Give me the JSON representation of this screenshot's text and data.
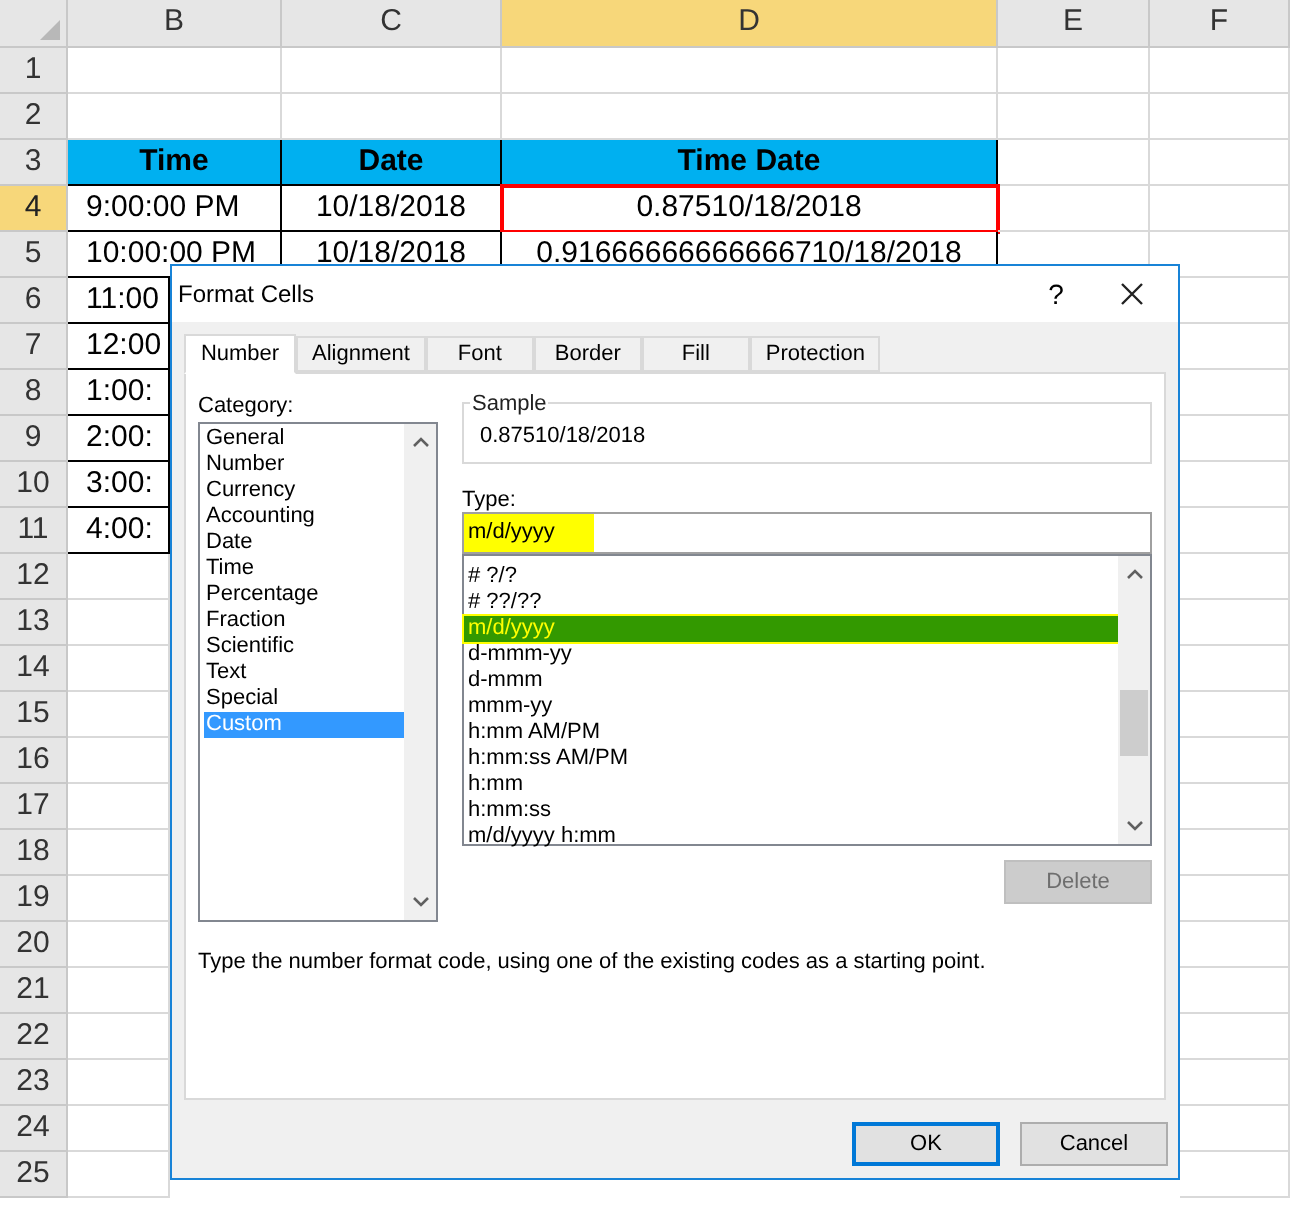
{
  "sheet": {
    "columns": [
      {
        "label": "B",
        "selected": false
      },
      {
        "label": "C",
        "selected": false
      },
      {
        "label": "D",
        "selected": true
      },
      {
        "label": "E",
        "selected": false
      },
      {
        "label": "F",
        "selected": false
      }
    ],
    "rows": [
      {
        "label": "1",
        "selected": false,
        "kind": "empty"
      },
      {
        "label": "2",
        "selected": false,
        "kind": "empty"
      },
      {
        "label": "3",
        "selected": false,
        "kind": "header",
        "cells": [
          {
            "text": "Time",
            "selected": false
          },
          {
            "text": "Date",
            "selected": false
          },
          {
            "text": "Time Date",
            "selected": false
          }
        ]
      },
      {
        "label": "4",
        "selected": true,
        "kind": "data",
        "cells": [
          {
            "text": "9:00:00 PM",
            "selected": false
          },
          {
            "text": "10/18/2018",
            "selected": false
          },
          {
            "text": "0.87510/18/2018",
            "selected": true
          }
        ]
      },
      {
        "label": "5",
        "selected": false,
        "kind": "data",
        "cells": [
          {
            "text": "10:00:00 PM",
            "selected": false
          },
          {
            "text": "10/18/2018",
            "selected": false
          },
          {
            "text": "0.91666666666666710/18/2018",
            "selected": false
          }
        ]
      },
      {
        "label": "6",
        "selected": false,
        "kind": "data",
        "cells": [
          {
            "text": "11:00",
            "selected": false
          }
        ]
      },
      {
        "label": "7",
        "selected": false,
        "kind": "data",
        "cells": [
          {
            "text": "12:00",
            "selected": false
          }
        ]
      },
      {
        "label": "8",
        "selected": false,
        "kind": "data",
        "cells": [
          {
            "text": "1:00:",
            "selected": false
          }
        ]
      },
      {
        "label": "9",
        "selected": false,
        "kind": "data",
        "cells": [
          {
            "text": "2:00:",
            "selected": false
          }
        ]
      },
      {
        "label": "10",
        "selected": false,
        "kind": "data",
        "cells": [
          {
            "text": "3:00:",
            "selected": false
          }
        ]
      },
      {
        "label": "11",
        "selected": false,
        "kind": "data",
        "cells": [
          {
            "text": "4:00:",
            "selected": false
          }
        ]
      },
      {
        "label": "12",
        "selected": false,
        "kind": "empty"
      },
      {
        "label": "13",
        "selected": false,
        "kind": "empty"
      },
      {
        "label": "14",
        "selected": false,
        "kind": "empty"
      },
      {
        "label": "15",
        "selected": false,
        "kind": "empty"
      },
      {
        "label": "16",
        "selected": false,
        "kind": "empty"
      },
      {
        "label": "17",
        "selected": false,
        "kind": "empty"
      },
      {
        "label": "18",
        "selected": false,
        "kind": "empty"
      },
      {
        "label": "19",
        "selected": false,
        "kind": "empty"
      },
      {
        "label": "20",
        "selected": false,
        "kind": "empty"
      },
      {
        "label": "21",
        "selected": false,
        "kind": "empty"
      },
      {
        "label": "22",
        "selected": false,
        "kind": "empty"
      },
      {
        "label": "23",
        "selected": false,
        "kind": "empty"
      },
      {
        "label": "24",
        "selected": false,
        "kind": "empty"
      },
      {
        "label": "25",
        "selected": false,
        "kind": "empty"
      }
    ]
  },
  "dialog": {
    "title": "Format Cells",
    "help": "?",
    "tabs": [
      {
        "label": "Number",
        "selected": true
      },
      {
        "label": "Alignment",
        "selected": false
      },
      {
        "label": "Font",
        "selected": false
      },
      {
        "label": "Border",
        "selected": false
      },
      {
        "label": "Fill",
        "selected": false
      },
      {
        "label": "Protection",
        "selected": false
      }
    ],
    "category_label": "Category:",
    "categories": [
      {
        "label": "General",
        "selected": false
      },
      {
        "label": "Number",
        "selected": false
      },
      {
        "label": "Currency",
        "selected": false
      },
      {
        "label": "Accounting",
        "selected": false
      },
      {
        "label": "Date",
        "selected": false
      },
      {
        "label": "Time",
        "selected": false
      },
      {
        "label": "Percentage",
        "selected": false
      },
      {
        "label": "Fraction",
        "selected": false
      },
      {
        "label": "Scientific",
        "selected": false
      },
      {
        "label": "Text",
        "selected": false
      },
      {
        "label": "Special",
        "selected": false
      },
      {
        "label": "Custom",
        "selected": true
      }
    ],
    "sample": {
      "label": "Sample",
      "value": "0.87510/18/2018"
    },
    "type": {
      "label": "Type:",
      "value": "m/d/yyyy",
      "highlighted": true
    },
    "formats": [
      {
        "label": "# ?/?",
        "selected": false
      },
      {
        "label": "# ??/??",
        "selected": false
      },
      {
        "label": "m/d/yyyy",
        "selected": true
      },
      {
        "label": "d-mmm-yy",
        "selected": false
      },
      {
        "label": "d-mmm",
        "selected": false
      },
      {
        "label": "mmm-yy",
        "selected": false
      },
      {
        "label": "h:mm AM/PM",
        "selected": false
      },
      {
        "label": "h:mm:ss AM/PM",
        "selected": false
      },
      {
        "label": "h:mm",
        "selected": false
      },
      {
        "label": "h:mm:ss",
        "selected": false
      },
      {
        "label": "m/d/yyyy h:mm",
        "selected": false
      }
    ],
    "delete": {
      "label": "Delete",
      "disabled": true
    },
    "hint": "Type the number format code, using one of the existing codes as a starting point.",
    "buttons": [
      {
        "label": "OK",
        "kind": "default"
      },
      {
        "label": "Cancel",
        "kind": "normal"
      }
    ]
  }
}
